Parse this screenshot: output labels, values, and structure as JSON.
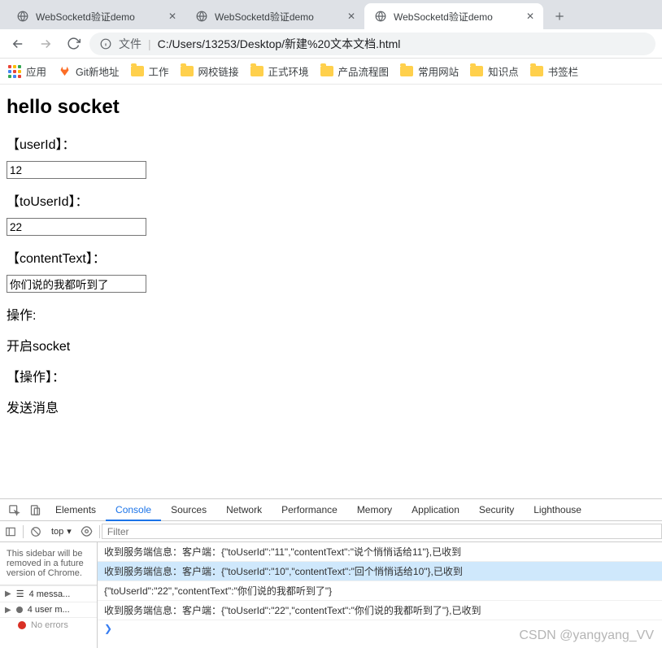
{
  "tabs": [
    {
      "title": "WebSocketd验证demo"
    },
    {
      "title": "WebSocketd验证demo"
    },
    {
      "title": "WebSocketd验证demo"
    }
  ],
  "addressbar": {
    "prefix": "文件",
    "url": "C:/Users/13253/Desktop/新建%20文本文档.html"
  },
  "bookmarks": {
    "apps": "应用",
    "gitlab": "Git新地址",
    "items": [
      "工作",
      "网校链接",
      "正式环境",
      "产品流程图",
      "常用网站",
      "知识点",
      "书签栏"
    ]
  },
  "page": {
    "heading": "hello socket",
    "userIdLabel": "【userId】：",
    "userIdValue": "12",
    "toUserIdLabel": "【toUserId】：",
    "toUserIdValue": "22",
    "contentTextLabel": "【contentText】：",
    "contentTextValue": "你们说的我都听到了",
    "opsLabel": "操作:",
    "openSocket": "开启socket",
    "ops2Label": "【操作】：",
    "sendMsg": "发送消息"
  },
  "devtools": {
    "tabs": [
      "Elements",
      "Console",
      "Sources",
      "Network",
      "Performance",
      "Memory",
      "Application",
      "Security",
      "Lighthouse"
    ],
    "context": "top",
    "filterPlaceholder": "Filter",
    "sidebarNote": "This sidebar will be removed in a future version of Chrome.",
    "msgCount": "4 messa...",
    "userCount": "4 user m...",
    "noErrors": "No errors",
    "lines": [
      "收到服务端信息：客户端：{\"toUserId\":\"11\",\"contentText\":\"说个悄悄话给11\"},已收到",
      "收到服务端信息：客户端：{\"toUserId\":\"10\",\"contentText\":\"回个悄悄话给10\"},已收到",
      "{\"toUserId\":\"22\",\"contentText\":\"你们说的我都听到了\"}",
      "收到服务端信息：客户端：{\"toUserId\":\"22\",\"contentText\":\"你们说的我都听到了\"},已收到"
    ]
  },
  "watermark": "CSDN @yangyang_VV"
}
